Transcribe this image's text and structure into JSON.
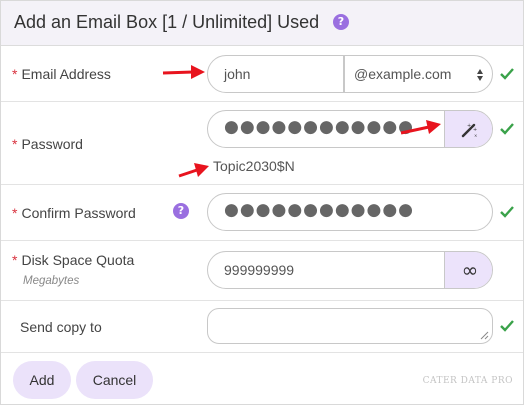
{
  "header": {
    "title": "Add an Email Box [1 / Unlimited] Used",
    "help_glyph": "?"
  },
  "required_mark": "*",
  "email": {
    "label": "Email Address",
    "value": "john",
    "domain": "@example.com",
    "valid": true
  },
  "password": {
    "label": "Password",
    "masked": "●●●●●●●●●●●●",
    "generated": "Topic2030$N",
    "generate_icon": "magic-wand-icon",
    "valid": true
  },
  "confirm_password": {
    "label": "Confirm Password",
    "help_glyph": "?",
    "masked": "●●●●●●●●●●●●",
    "valid": true
  },
  "quota": {
    "label": "Disk Space Quota",
    "sublabel": "Megabytes",
    "value": "999999999",
    "unlimited_glyph": "∞",
    "valid": false
  },
  "send_copy": {
    "label": "Send copy to",
    "value": "",
    "valid": true
  },
  "actions": {
    "add_label": "Add",
    "cancel_label": "Cancel"
  },
  "watermark": "CATER DATA PRO",
  "colors": {
    "accent": "#9a6fe0",
    "check": "#3aa24a",
    "required": "#d9333f",
    "arrow": "#e8141e",
    "button_bg": "#ebe2fa",
    "header_bg": "#f4f2f8"
  }
}
